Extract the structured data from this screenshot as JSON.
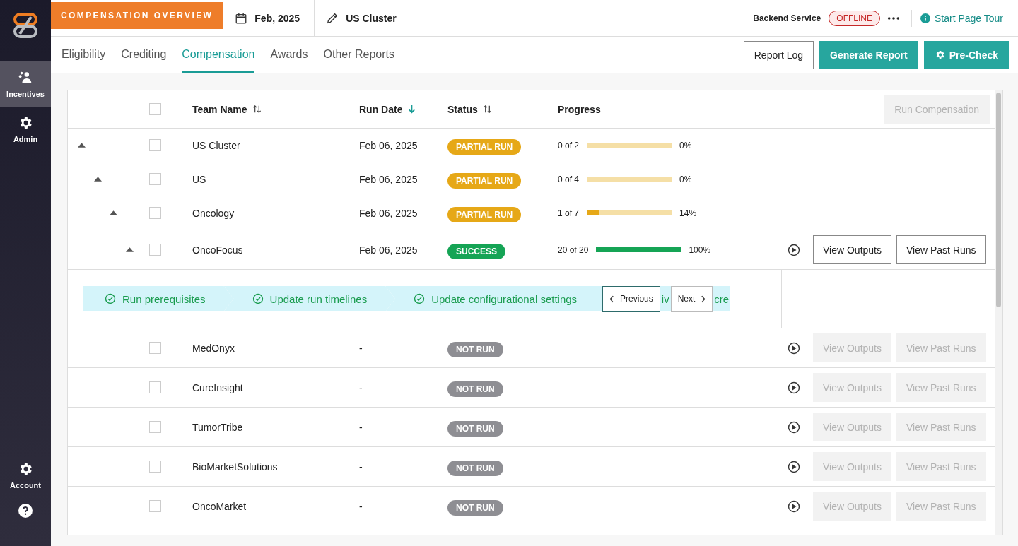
{
  "sidebar": {
    "items": [
      {
        "label": "Incentives",
        "selected": true
      },
      {
        "label": "Admin",
        "selected": false
      }
    ],
    "bottom_items": [
      {
        "label": "Account"
      }
    ]
  },
  "header": {
    "title": "COMPENSATION OVERVIEW",
    "date": "Feb, 2025",
    "cluster": "US Cluster",
    "service_label": "Backend Service",
    "service_status": "OFFLINE",
    "tour_link": "Start Page Tour"
  },
  "tabs": [
    {
      "label": "Eligibility",
      "selected": false
    },
    {
      "label": "Crediting",
      "selected": false
    },
    {
      "label": "Compensation",
      "selected": true
    },
    {
      "label": "Awards",
      "selected": false
    },
    {
      "label": "Other Reports",
      "selected": false
    }
  ],
  "actions": [
    {
      "label": "Report Log",
      "kind": "outline"
    },
    {
      "label": "Generate Report",
      "kind": "primary"
    },
    {
      "label": "Pre-Check",
      "kind": "primary-gear"
    }
  ],
  "table": {
    "header_checkbox": {
      "checked": false
    },
    "columns": [
      {
        "label": "Team Name",
        "sort_active": false
      },
      {
        "label": "Run Date",
        "sort_active": true
      },
      {
        "label": "Status",
        "sort_active": false
      },
      {
        "label": "Progress"
      }
    ],
    "run_button": {
      "label": "Run Compensation",
      "disabled": true
    },
    "rows": [
      {
        "name": "US Cluster",
        "run_date": "Feb 06, 2025",
        "checked": false,
        "expanded": true,
        "status": {
          "label": "PARTIAL RUN",
          "kind": "partial"
        },
        "progress": {
          "text": "0 of 2",
          "level": 0,
          "percent": "0%"
        },
        "children": [
          {
            "name": "US",
            "run_date": "Feb 06, 2025",
            "checked": false,
            "expanded": true,
            "status": {
              "label": "PARTIAL RUN",
              "kind": "partial"
            },
            "progress": {
              "text": "0 of 4",
              "level": 0,
              "percent": "0%"
            },
            "children": [
              {
                "name": "Oncology",
                "run_date": "Feb 06, 2025",
                "checked": false,
                "expanded": true,
                "status": {
                  "label": "PARTIAL RUN",
                  "kind": "partial"
                },
                "progress": {
                  "text": "1 of 7",
                  "level": 0.14,
                  "percent": "14%"
                },
                "children": [
                  {
                    "name": "OncoFocus",
                    "run_date": "Feb 06, 2025",
                    "checked": false,
                    "expanded": true,
                    "status": {
                      "label": "SUCCESS",
                      "kind": "success"
                    },
                    "progress": {
                      "text": "20 of 20",
                      "level": 1,
                      "percent": "100%"
                    },
                    "row_actions": {
                      "disabled": false,
                      "buttons": [
                        "View Outputs",
                        "View Past Runs"
                      ]
                    },
                    "stepper": [
                      {
                        "kind": "step",
                        "label": "Run prerequisites",
                        "done": true
                      },
                      {
                        "kind": "step",
                        "label": "Update run timelines",
                        "done": true
                      },
                      {
                        "kind": "step",
                        "label": "Update configurational settings",
                        "done": true
                      },
                      {
                        "kind": "prev",
                        "label": "Previous"
                      },
                      {
                        "kind": "fragment",
                        "label": "iv"
                      },
                      {
                        "kind": "next",
                        "label": "Next"
                      },
                      {
                        "kind": "fragment",
                        "label": "cre"
                      }
                    ]
                  },
                  {
                    "name": "MedOnyx",
                    "run_date": "-",
                    "checked": false,
                    "status": {
                      "label": "NOT RUN",
                      "kind": "not_run"
                    },
                    "row_actions": {
                      "disabled": true,
                      "buttons": [
                        "View Outputs",
                        "View Past Runs"
                      ]
                    }
                  },
                  {
                    "name": "CureInsight",
                    "run_date": "-",
                    "checked": false,
                    "status": {
                      "label": "NOT RUN",
                      "kind": "not_run"
                    },
                    "row_actions": {
                      "disabled": true,
                      "buttons": [
                        "View Outputs",
                        "View Past Runs"
                      ]
                    }
                  },
                  {
                    "name": "TumorTribe",
                    "run_date": "-",
                    "checked": false,
                    "status": {
                      "label": "NOT RUN",
                      "kind": "not_run"
                    },
                    "row_actions": {
                      "disabled": true,
                      "buttons": [
                        "View Outputs",
                        "View Past Runs"
                      ]
                    }
                  },
                  {
                    "name": "BioMarketSolutions",
                    "run_date": "-",
                    "checked": false,
                    "status": {
                      "label": "NOT RUN",
                      "kind": "not_run"
                    },
                    "row_actions": {
                      "disabled": true,
                      "buttons": [
                        "View Outputs",
                        "View Past Runs"
                      ]
                    }
                  },
                  {
                    "name": "OncoMarket",
                    "run_date": "-",
                    "checked": false,
                    "status": {
                      "label": "NOT RUN",
                      "kind": "not_run"
                    },
                    "row_actions": {
                      "disabled": true,
                      "buttons": [
                        "View Outputs",
                        "View Past Runs"
                      ]
                    }
                  }
                ]
              }
            ]
          }
        ]
      }
    ]
  }
}
